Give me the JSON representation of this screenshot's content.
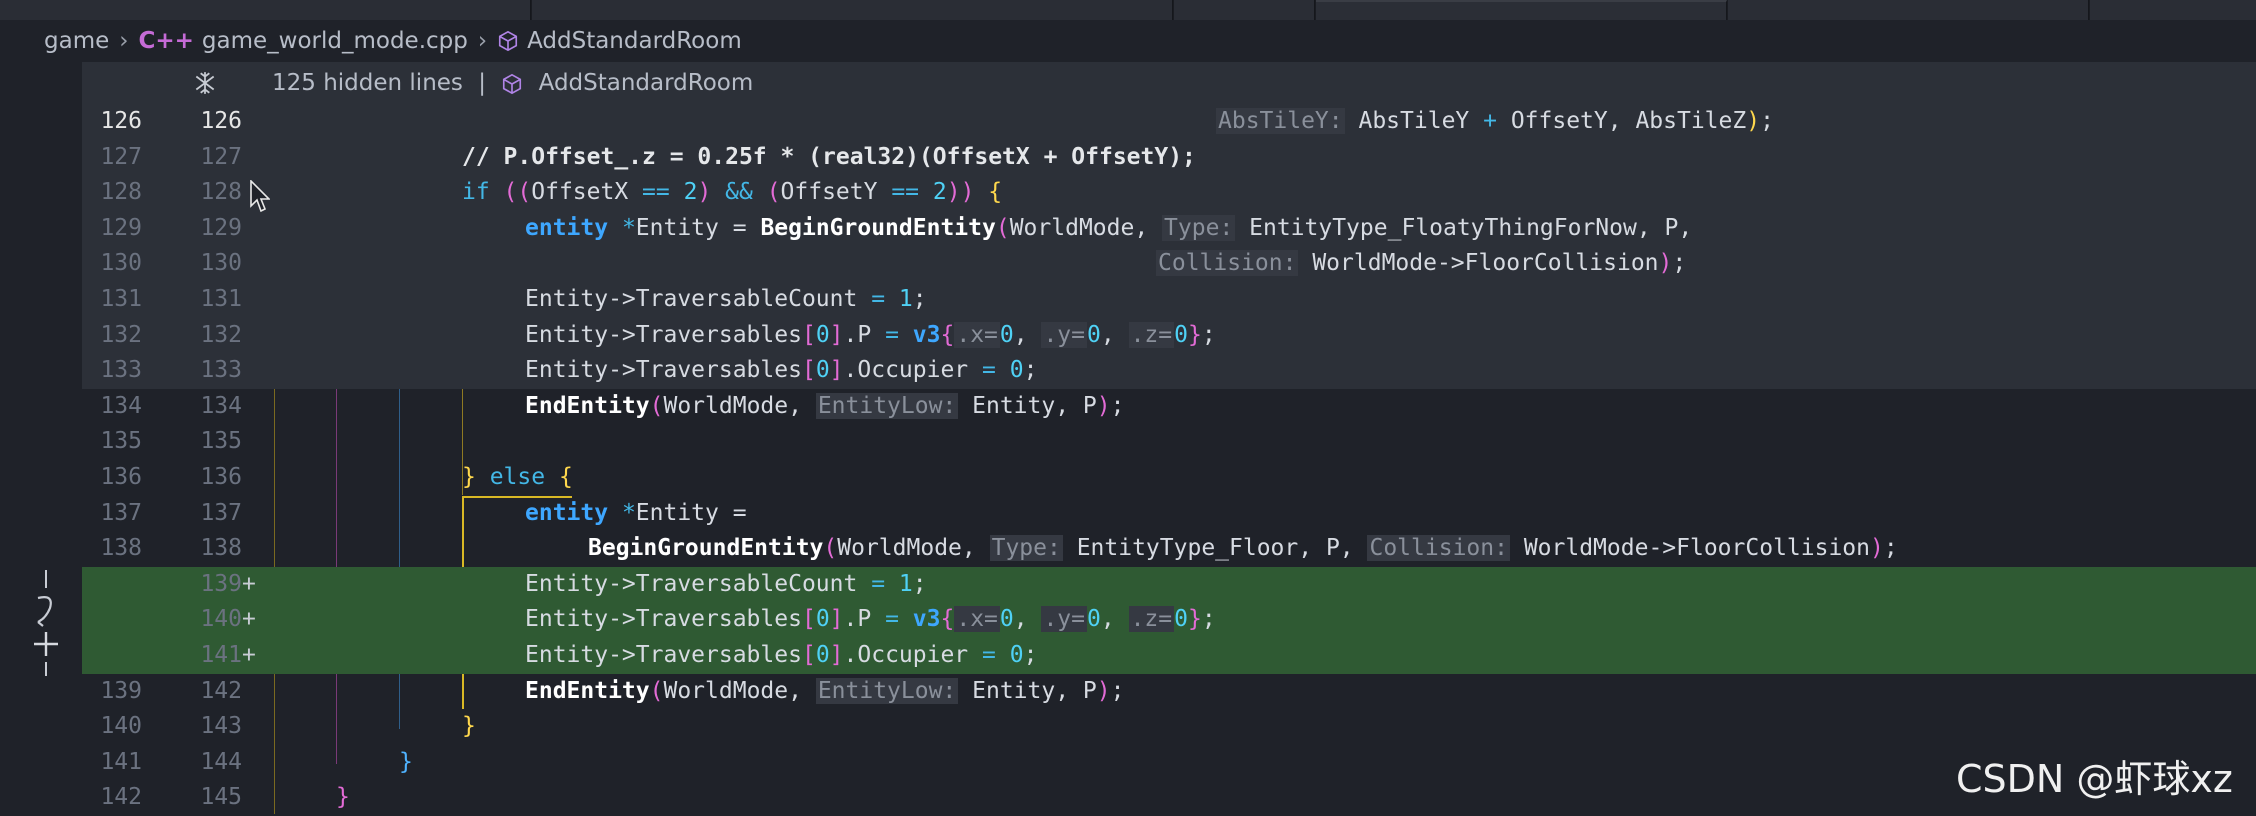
{
  "breadcrumb": {
    "root": "game",
    "file": "game_world_mode.cpp",
    "symbol": "AddStandardRoom",
    "file_icon": "c++-file-icon",
    "symbol_icon": "cube-icon"
  },
  "hidden_bar": {
    "text": "125 hidden lines",
    "symbol": "AddStandardRoom",
    "separator": "|"
  },
  "watermark": "CSDN @虾球xz",
  "colors": {
    "added_line": "#2f5a33",
    "current_line": "#2c3038",
    "keyword": "#3ea7ff"
  },
  "lines": [
    {
      "old": "126",
      "new": "126",
      "current": true
    },
    {
      "old": "127",
      "new": "127"
    },
    {
      "old": "128",
      "new": "128"
    },
    {
      "old": "129",
      "new": "129"
    },
    {
      "old": "130",
      "new": "130"
    },
    {
      "old": "131",
      "new": "131"
    },
    {
      "old": "132",
      "new": "132"
    },
    {
      "old": "133",
      "new": "133"
    },
    {
      "old": "134",
      "new": "134"
    },
    {
      "old": "135",
      "new": "135"
    },
    {
      "old": "136",
      "new": "136"
    },
    {
      "old": "137",
      "new": "137"
    },
    {
      "old": "138",
      "new": "138"
    },
    {
      "old": "",
      "new": "139",
      "mark": "+",
      "added": true
    },
    {
      "old": "",
      "new": "140",
      "mark": "+",
      "added": true
    },
    {
      "old": "",
      "new": "141",
      "mark": "+",
      "added": true
    },
    {
      "old": "139",
      "new": "142"
    },
    {
      "old": "140",
      "new": "143"
    },
    {
      "old": "141",
      "new": "144"
    },
    {
      "old": "142",
      "new": "145"
    }
  ],
  "code": {
    "l126": {
      "hint": "AbsTileY:",
      "a": "AbsTileY ",
      "plus": "+",
      "b": " OffsetY, AbsTileZ",
      "close": ")",
      ";": ";"
    },
    "l127": "// P.Offset_.z = 0.25f * (real32)(OffsetX + OffsetY);",
    "l128": {
      "kw": "if",
      "o1": " ((",
      "a": "OffsetX ",
      "eq": "==",
      "n1": " 2",
      "c1": ") ",
      "and": "&&",
      "o2": " (",
      "b": "OffsetY ",
      "eq2": "==",
      "n2": " 2",
      "c2": ")) ",
      "brace": "{"
    },
    "l129": {
      "type": "entity",
      "star": " *",
      "var": "Entity ",
      "eq": "= ",
      "fn": "BeginGroundEntity",
      "open": "(",
      "a": "WorldMode, ",
      "hint": "Type:",
      "b": " EntityType_FloatyThingForNow, P,"
    },
    "l130": {
      "hint": "Collision:",
      "a": " WorldMode->FloorCollision",
      "close": ")",
      ";": ";"
    },
    "l131": {
      "a": "Entity->TraversableCount ",
      "eq": "=",
      "n": " 1",
      ";": ";"
    },
    "l132": {
      "a": "Entity->Traversables",
      "o": "[",
      "n": "0",
      "c": "]",
      ".P": ".P ",
      "eq": "=",
      "fn": " v3",
      "ob": "{",
      "mx": ".x=",
      "n1": "0",
      ",1": ", ",
      "my": ".y=",
      "n2": "0",
      ",2": ", ",
      "mz": ".z=",
      "n3": "0",
      "cb": "}",
      ";": ";"
    },
    "l133": {
      "a": "Entity->Traversables",
      "o": "[",
      "n": "0",
      "c": "]",
      "b": ".Occupier ",
      "eq": "=",
      "n2": " 0",
      ";": ";"
    },
    "l134": {
      "fn": "EndEntity",
      "open": "(",
      "a": "WorldMode, ",
      "hint": "EntityLow:",
      "b": " Entity, P",
      "close": ")",
      ";": ";"
    },
    "l136": {
      "brace": "}",
      "kw": " else ",
      "brace2": "{"
    },
    "l137": {
      "type": "entity",
      "star": " *",
      "var": "Entity ",
      "eq": "="
    },
    "l138": {
      "fn": "BeginGroundEntity",
      "open": "(",
      "a": "WorldMode, ",
      "hint": "Type:",
      "b": " EntityType_Floor, P, ",
      "hint2": "Collision:",
      "c": " WorldMode->FloorCollision",
      "close": ")",
      ";": ";"
    },
    "l143": "}",
    "l144": "}",
    "l145": "}"
  }
}
